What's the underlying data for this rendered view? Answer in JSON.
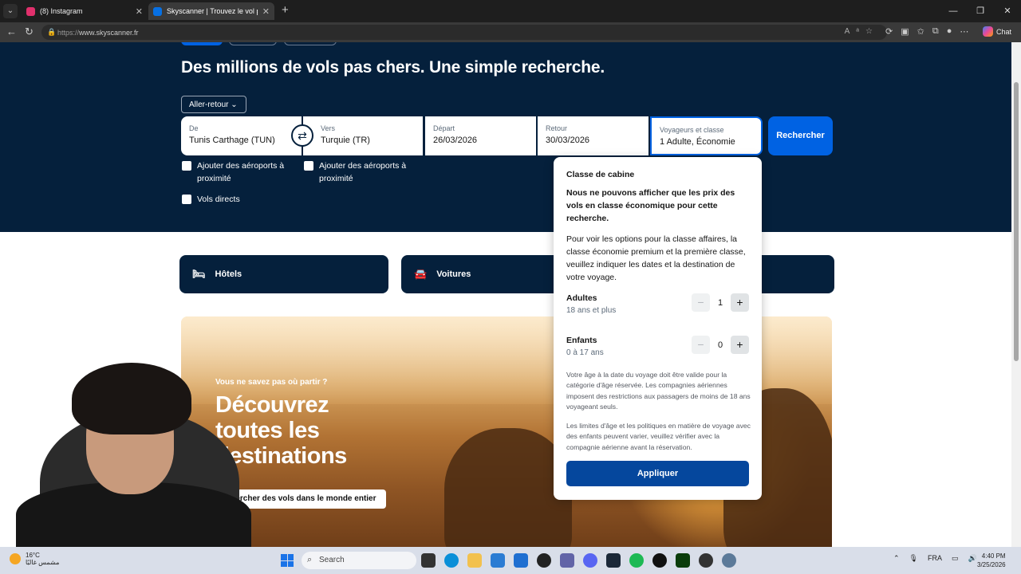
{
  "browser": {
    "tabs": [
      {
        "title": "(8) Instagram",
        "icon": "instagram-icon",
        "color": "#e1306c"
      },
      {
        "title": "Skyscanner | Trouvez le vol pas che",
        "icon": "skyscanner-icon",
        "color": "#0770e3"
      }
    ],
    "url_prefix": "https://",
    "url_host": "www.skyscanner.fr",
    "chat_label": "Chat"
  },
  "hero": {
    "title": "Des millions de vols pas chers. Une simple recherche.",
    "trip_type": "Aller-retour",
    "from": {
      "label": "De",
      "value": "Tunis Carthage (TUN)"
    },
    "to": {
      "label": "Vers",
      "value": "Turquie (TR)"
    },
    "depart": {
      "label": "Départ",
      "value": "26/03/2026"
    },
    "return": {
      "label": "Retour",
      "value": "30/03/2026"
    },
    "travellers": {
      "label": "Voyageurs et classe",
      "value": "1 Adulte, Économie"
    },
    "search_label": "Rechercher",
    "nearby_from": "Ajouter des aéroports à proximité",
    "nearby_to": "Ajouter des aéroports à proximité",
    "direct": "Vols directs"
  },
  "services": {
    "hotels": "Hôtels",
    "cars": "Voitures"
  },
  "banner": {
    "kicker": "Vous ne savez pas où partir ?",
    "headline": "Découvrez toutes les destinations",
    "cta": "Chercher des vols dans le monde entier"
  },
  "popover": {
    "title": "Classe de cabine",
    "warning": "Nous ne pouvons afficher que les prix des vols en classe économique pour cette recherche.",
    "info": "Pour voir les options pour la classe affaires, la classe économie premium et la première classe, veuillez indiquer les dates et la destination de votre voyage.",
    "adults": {
      "label": "Adultes",
      "sub": "18 ans et plus",
      "count": "1"
    },
    "children": {
      "label": "Enfants",
      "sub": "0 à 17 ans",
      "count": "0"
    },
    "note1": "Votre âge à la date du voyage doit être valide pour la catégorie d'âge réservée. Les compagnies aériennes imposent des restrictions aux passagers de moins de 18 ans voyageant seuls.",
    "note2": "Les limites d'âge et les politiques en matière de voyage avec des enfants peuvent varier, veuillez vérifier avec la compagnie aérienne avant la réservation.",
    "apply": "Appliquer"
  },
  "taskbar": {
    "temp": "16°C",
    "weather": "مشمس غالبًا",
    "search": "Search",
    "lang": "FRA",
    "time": "4:40 PM",
    "date": "3/25/2026"
  },
  "colors": {
    "navy": "#05203c",
    "blue": "#0062e3",
    "apply": "#05479d"
  }
}
